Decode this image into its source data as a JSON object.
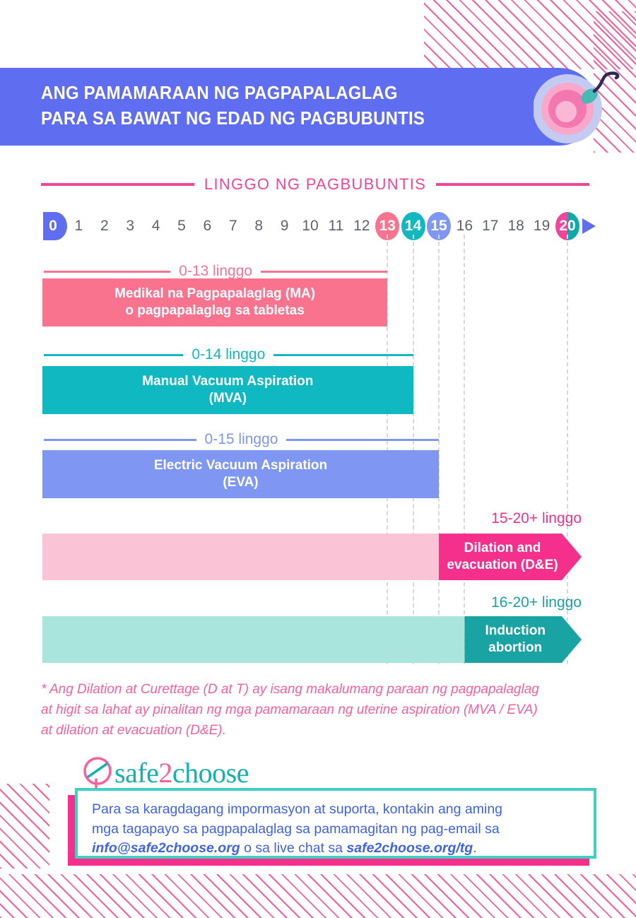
{
  "header": {
    "title": "ANG PAMAMARAAN NG PAGPAPALAGLAG\nPARA SA BAWAT NG EDAD NG PAGBUBUNTIS",
    "icon": "ovum-sperm-icon",
    "background_color": "#5f6df0"
  },
  "scale": {
    "label": "LINGGO NG PAGBUBUNTIS",
    "rule_color": "#f0469a",
    "arrow_color": "#5f6df0",
    "weeks": [
      {
        "label": "0",
        "style": "zero"
      },
      {
        "label": "1",
        "style": "plain"
      },
      {
        "label": "2",
        "style": "plain"
      },
      {
        "label": "3",
        "style": "plain"
      },
      {
        "label": "4",
        "style": "plain"
      },
      {
        "label": "5",
        "style": "plain"
      },
      {
        "label": "6",
        "style": "plain"
      },
      {
        "label": "7",
        "style": "plain"
      },
      {
        "label": "8",
        "style": "plain"
      },
      {
        "label": "9",
        "style": "plain"
      },
      {
        "label": "10",
        "style": "plain"
      },
      {
        "label": "11",
        "style": "plain"
      },
      {
        "label": "12",
        "style": "plain"
      },
      {
        "label": "13",
        "style": "pink"
      },
      {
        "label": "14",
        "style": "teal"
      },
      {
        "label": "15",
        "style": "blue"
      },
      {
        "label": "16",
        "style": "plain"
      },
      {
        "label": "17",
        "style": "plain"
      },
      {
        "label": "18",
        "style": "plain"
      },
      {
        "label": "19",
        "style": "plain"
      },
      {
        "label": "20",
        "style": "split"
      }
    ]
  },
  "methods": [
    {
      "range_label": "0-13 linggo",
      "name": "Medikal na Pagpapalaglag (MA)\no pagpapalaglag sa tabletas",
      "start_week": 0,
      "end_week": 13,
      "color": "#f9738f",
      "label_color": "#f9738f",
      "shape": "bar"
    },
    {
      "range_label": "0-14 linggo",
      "name": "Manual Vacuum Aspiration\n(MVA)",
      "start_week": 0,
      "end_week": 14,
      "color": "#10b8c1",
      "label_color": "#10b8c1",
      "shape": "bar"
    },
    {
      "range_label": "0-15 linggo",
      "name": "Electric Vacuum Aspiration\n(EVA)",
      "start_week": 0,
      "end_week": 15,
      "color": "#7f96f3",
      "label_color": "#7f96f3",
      "shape": "bar"
    },
    {
      "range_label": "15-20+ linggo",
      "name": "Dilation and\nevacuation (D&E)",
      "start_week": 15,
      "end_week": 21,
      "color": "#f5308c",
      "track_color": "#fbc4d6",
      "label_color": "#f5308c",
      "shape": "arrow"
    },
    {
      "range_label": "16-20+ linggo",
      "name": "Induction\nabortion",
      "start_week": 16,
      "end_week": 21,
      "color": "#1aa3a3",
      "track_color": "#aae5dd",
      "label_color": "#1aa3a3",
      "shape": "arrow"
    }
  ],
  "footnote": "* Ang Dilation at Curettage (D at T) ay isang makalumang paraan ng pagpapalaglag\nat higit sa lahat ay pinalitan ng mga pamamaraan ng uterine aspiration (MVA / EVA)\nat dilation at evacuation (D&E).",
  "logo": {
    "mark": "q-circle-slash-icon",
    "part1": "safe",
    "part2": "2",
    "part3": "choose"
  },
  "contact": {
    "line1": "Para sa karagdagang impormasyon at suporta, kontakin ang aming",
    "line2": "mga tagapayo sa pagpapalaglag sa pamamagitan ng pag-email sa",
    "email": "info@safe2choose.org",
    "mid": " o sa live chat sa ",
    "site": "safe2choose.org/tg",
    "end": ".",
    "border_color": "#3ed0c0",
    "shadow_color": "#f5308c",
    "text_color": "#3f63e8"
  },
  "decor": {
    "stripe_color": "#f7609c"
  },
  "chart_data": {
    "type": "bar",
    "title": "ANG PAMAMARAAN NG PAGPAPALAGLAG PARA SA BAWAT NG EDAD NG PAGBUBUNTIS",
    "xlabel": "LINGGO NG PAGBUBUNTIS",
    "ylabel": "",
    "xlim": [
      0,
      21
    ],
    "x_ticks": [
      0,
      1,
      2,
      3,
      4,
      5,
      6,
      7,
      8,
      9,
      10,
      11,
      12,
      13,
      14,
      15,
      16,
      17,
      18,
      19,
      20
    ],
    "grid": "dashed vertical guides at weeks 13, 14, 15, 16, 20",
    "legend": "none",
    "series": [
      {
        "name": "Medikal na Pagpapalaglag (MA) o pagpapalaglag sa tabletas",
        "start": 0,
        "end": 13,
        "color": "#f9738f"
      },
      {
        "name": "Manual Vacuum Aspiration (MVA)",
        "start": 0,
        "end": 14,
        "color": "#10b8c1"
      },
      {
        "name": "Electric Vacuum Aspiration (EVA)",
        "start": 0,
        "end": 15,
        "color": "#7f96f3"
      },
      {
        "name": "Dilation and evacuation (D&E)",
        "start": 15,
        "end": 21,
        "color": "#f5308c"
      },
      {
        "name": "Induction abortion",
        "start": 16,
        "end": 21,
        "color": "#1aa3a3"
      }
    ]
  }
}
